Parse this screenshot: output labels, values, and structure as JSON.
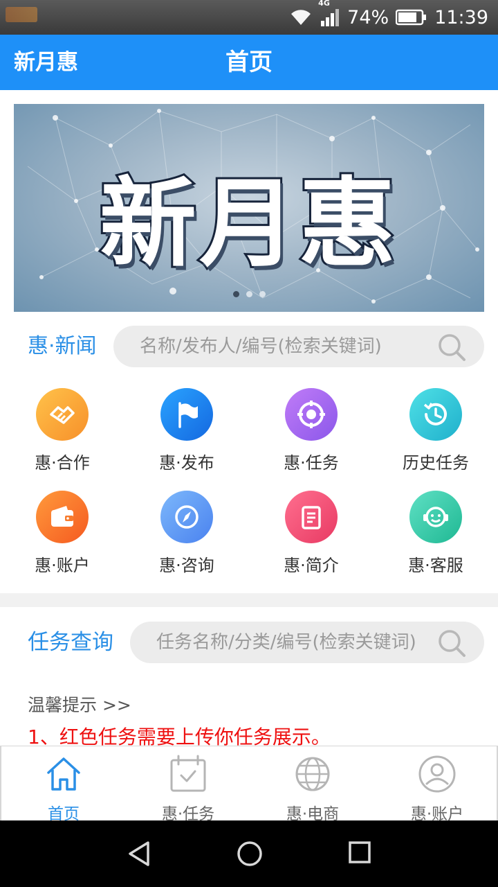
{
  "status_bar": {
    "network": "4G",
    "battery": "74%",
    "time": "11:39"
  },
  "header": {
    "brand": "新月惠",
    "title": "首页"
  },
  "banner": {
    "text": "新月惠",
    "slide_count": 3,
    "active_slide": 1
  },
  "news": {
    "title": "惠·新闻",
    "search_placeholder": "名称/发布人/编号(检索关键词)"
  },
  "grid": [
    {
      "label": "惠·合作",
      "icon": "handshake-icon",
      "color": "#f9a23b"
    },
    {
      "label": "惠·发布",
      "icon": "flag-icon",
      "color": "#1e88f0"
    },
    {
      "label": "惠·任务",
      "icon": "target-icon",
      "color": "#a56cf0"
    },
    {
      "label": "历史任务",
      "icon": "history-icon",
      "color": "#2ec8d6"
    },
    {
      "label": "惠·账户",
      "icon": "wallet-icon",
      "color": "#fb7a2e"
    },
    {
      "label": "惠·咨询",
      "icon": "compass-icon",
      "color": "#5b9cf6"
    },
    {
      "label": "惠·简介",
      "icon": "document-icon",
      "color": "#ef4a73"
    },
    {
      "label": "惠·客服",
      "icon": "customer-service-icon",
      "color": "#2ec9a8"
    }
  ],
  "task_query": {
    "title": "任务查询",
    "search_placeholder": "任务名称/分类/编号(检索关键词)"
  },
  "tips": {
    "title": "温馨提示 >>",
    "line1": "1、红色任务需要上传你任务展示。"
  },
  "tabs": [
    {
      "label": "首页",
      "icon": "home-icon",
      "active": true
    },
    {
      "label": "惠·任务",
      "icon": "calendar-check-icon",
      "active": false
    },
    {
      "label": "惠·电商",
      "icon": "globe-icon",
      "active": false
    },
    {
      "label": "惠·账户",
      "icon": "user-icon",
      "active": false
    }
  ],
  "colors": {
    "primary": "#1e90f8",
    "accent_text": "#2a8fe6",
    "warning": "#ee1111"
  }
}
